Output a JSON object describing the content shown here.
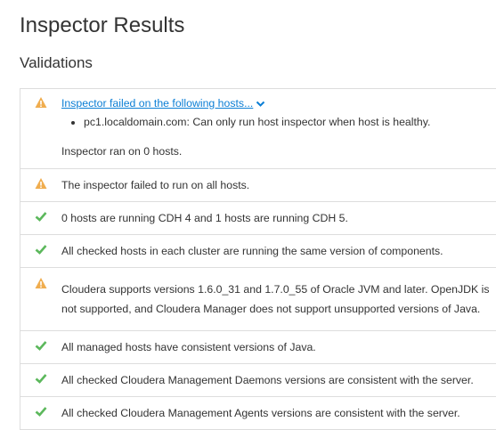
{
  "page": {
    "title": "Inspector Results",
    "section_title": "Validations"
  },
  "colors": {
    "warning": "#f0ad4e",
    "success": "#5cb85c",
    "link": "#0b7ed5"
  },
  "validations": [
    {
      "status": "warning",
      "icon": "warning-icon",
      "label": "Inspector failed on the following hosts...",
      "hosts": [
        "pc1.localdomain.com: Can only run host inspector when host is healthy."
      ],
      "note": "Inspector ran on 0 hosts."
    },
    {
      "status": "warning",
      "icon": "warning-icon",
      "text": "The inspector failed to run on all hosts."
    },
    {
      "status": "success",
      "icon": "check-icon",
      "text": "0 hosts are running CDH 4 and 1 hosts are running CDH 5."
    },
    {
      "status": "success",
      "icon": "check-icon",
      "text": "All checked hosts in each cluster are running the same version of components."
    },
    {
      "status": "warning",
      "icon": "warning-icon",
      "text": "Cloudera supports versions 1.6.0_31 and 1.7.0_55 of Oracle JVM and later. OpenJDK is not supported, and Cloudera Manager does not support unsupported versions of Java."
    },
    {
      "status": "success",
      "icon": "check-icon",
      "text": "All managed hosts have consistent versions of Java."
    },
    {
      "status": "success",
      "icon": "check-icon",
      "text": "All checked Cloudera Management Daemons versions are consistent with the server."
    },
    {
      "status": "success",
      "icon": "check-icon",
      "text": "All checked Cloudera Management Agents versions are consistent with the server."
    }
  ]
}
